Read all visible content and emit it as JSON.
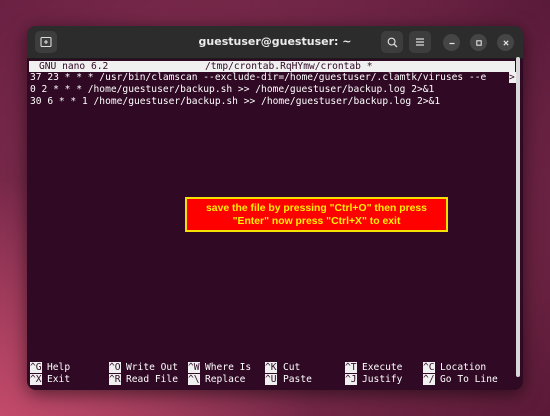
{
  "window": {
    "title": "guestuser@guestuser: ~",
    "icons": {
      "new_tab": "new-tab-icon",
      "search": "search-icon",
      "menu": "hamburger-menu-icon",
      "minimize": "minimize-icon",
      "maximize": "maximize-icon",
      "close": "close-icon"
    }
  },
  "nano": {
    "version": "GNU nano 6.2",
    "filename": "/tmp/crontab.RqHYmw/crontab *",
    "truncation_marker": ">",
    "lines": [
      "37 23 * * * /usr/bin/clamscan --exclude-dir=/home/guestuser/.clamtk/viruses --e",
      "0 2 * * * /home/guestuser/backup.sh >> /home/guestuser/backup.log 2>&1",
      "30 6 * * 1 /home/guestuser/backup.sh >> /home/guestuser/backup.log 2>&1"
    ],
    "shortcuts_row1": [
      {
        "key": "^G",
        "label": "Help"
      },
      {
        "key": "^O",
        "label": "Write Out"
      },
      {
        "key": "^W",
        "label": "Where Is"
      },
      {
        "key": "^K",
        "label": "Cut"
      },
      {
        "key": "^T",
        "label": "Execute"
      },
      {
        "key": "^C",
        "label": "Location"
      }
    ],
    "shortcuts_row2": [
      {
        "key": "^X",
        "label": "Exit"
      },
      {
        "key": "^R",
        "label": "Read File"
      },
      {
        "key": "^\\",
        "label": "Replace"
      },
      {
        "key": "^U",
        "label": "Paste"
      },
      {
        "key": "^J",
        "label": "Justify"
      },
      {
        "key": "^/",
        "label": "Go To Line"
      }
    ]
  },
  "annotation": {
    "line1": "save the file by pressing \"Ctrl+O\" then press",
    "line2": "\"Enter\" now press \"Ctrl+X\" to exit"
  }
}
